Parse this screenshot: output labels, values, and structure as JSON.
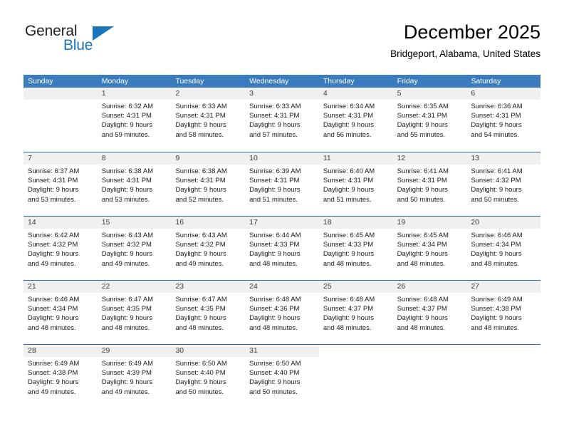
{
  "brand": {
    "word1": "General",
    "word2": "Blue",
    "triangle_color": "#1b75bb",
    "logo_icon": "general-blue-triangle-logo"
  },
  "header": {
    "title": "December 2025",
    "subtitle": "Bridgeport, Alabama, United States"
  },
  "theme": {
    "header_blue": "#3a7cbe",
    "row_divider_blue": "#2b6cad",
    "day_header_gray": "#f0f0f0",
    "text_color": "#000000"
  },
  "weekdays": [
    "Sunday",
    "Monday",
    "Tuesday",
    "Wednesday",
    "Thursday",
    "Friday",
    "Saturday"
  ],
  "weeks": [
    [
      {
        "day": "",
        "sunrise": "",
        "sunset": "",
        "daylight1": "",
        "daylight2": "",
        "empty": true
      },
      {
        "day": "1",
        "sunrise": "Sunrise: 6:32 AM",
        "sunset": "Sunset: 4:31 PM",
        "daylight1": "Daylight: 9 hours",
        "daylight2": "and 59 minutes.",
        "empty": false
      },
      {
        "day": "2",
        "sunrise": "Sunrise: 6:33 AM",
        "sunset": "Sunset: 4:31 PM",
        "daylight1": "Daylight: 9 hours",
        "daylight2": "and 58 minutes.",
        "empty": false
      },
      {
        "day": "3",
        "sunrise": "Sunrise: 6:33 AM",
        "sunset": "Sunset: 4:31 PM",
        "daylight1": "Daylight: 9 hours",
        "daylight2": "and 57 minutes.",
        "empty": false
      },
      {
        "day": "4",
        "sunrise": "Sunrise: 6:34 AM",
        "sunset": "Sunset: 4:31 PM",
        "daylight1": "Daylight: 9 hours",
        "daylight2": "and 56 minutes.",
        "empty": false
      },
      {
        "day": "5",
        "sunrise": "Sunrise: 6:35 AM",
        "sunset": "Sunset: 4:31 PM",
        "daylight1": "Daylight: 9 hours",
        "daylight2": "and 55 minutes.",
        "empty": false
      },
      {
        "day": "6",
        "sunrise": "Sunrise: 6:36 AM",
        "sunset": "Sunset: 4:31 PM",
        "daylight1": "Daylight: 9 hours",
        "daylight2": "and 54 minutes.",
        "empty": false
      }
    ],
    [
      {
        "day": "7",
        "sunrise": "Sunrise: 6:37 AM",
        "sunset": "Sunset: 4:31 PM",
        "daylight1": "Daylight: 9 hours",
        "daylight2": "and 53 minutes.",
        "empty": false
      },
      {
        "day": "8",
        "sunrise": "Sunrise: 6:38 AM",
        "sunset": "Sunset: 4:31 PM",
        "daylight1": "Daylight: 9 hours",
        "daylight2": "and 53 minutes.",
        "empty": false
      },
      {
        "day": "9",
        "sunrise": "Sunrise: 6:38 AM",
        "sunset": "Sunset: 4:31 PM",
        "daylight1": "Daylight: 9 hours",
        "daylight2": "and 52 minutes.",
        "empty": false
      },
      {
        "day": "10",
        "sunrise": "Sunrise: 6:39 AM",
        "sunset": "Sunset: 4:31 PM",
        "daylight1": "Daylight: 9 hours",
        "daylight2": "and 51 minutes.",
        "empty": false
      },
      {
        "day": "11",
        "sunrise": "Sunrise: 6:40 AM",
        "sunset": "Sunset: 4:31 PM",
        "daylight1": "Daylight: 9 hours",
        "daylight2": "and 51 minutes.",
        "empty": false
      },
      {
        "day": "12",
        "sunrise": "Sunrise: 6:41 AM",
        "sunset": "Sunset: 4:31 PM",
        "daylight1": "Daylight: 9 hours",
        "daylight2": "and 50 minutes.",
        "empty": false
      },
      {
        "day": "13",
        "sunrise": "Sunrise: 6:41 AM",
        "sunset": "Sunset: 4:32 PM",
        "daylight1": "Daylight: 9 hours",
        "daylight2": "and 50 minutes.",
        "empty": false
      }
    ],
    [
      {
        "day": "14",
        "sunrise": "Sunrise: 6:42 AM",
        "sunset": "Sunset: 4:32 PM",
        "daylight1": "Daylight: 9 hours",
        "daylight2": "and 49 minutes.",
        "empty": false
      },
      {
        "day": "15",
        "sunrise": "Sunrise: 6:43 AM",
        "sunset": "Sunset: 4:32 PM",
        "daylight1": "Daylight: 9 hours",
        "daylight2": "and 49 minutes.",
        "empty": false
      },
      {
        "day": "16",
        "sunrise": "Sunrise: 6:43 AM",
        "sunset": "Sunset: 4:32 PM",
        "daylight1": "Daylight: 9 hours",
        "daylight2": "and 49 minutes.",
        "empty": false
      },
      {
        "day": "17",
        "sunrise": "Sunrise: 6:44 AM",
        "sunset": "Sunset: 4:33 PM",
        "daylight1": "Daylight: 9 hours",
        "daylight2": "and 48 minutes.",
        "empty": false
      },
      {
        "day": "18",
        "sunrise": "Sunrise: 6:45 AM",
        "sunset": "Sunset: 4:33 PM",
        "daylight1": "Daylight: 9 hours",
        "daylight2": "and 48 minutes.",
        "empty": false
      },
      {
        "day": "19",
        "sunrise": "Sunrise: 6:45 AM",
        "sunset": "Sunset: 4:34 PM",
        "daylight1": "Daylight: 9 hours",
        "daylight2": "and 48 minutes.",
        "empty": false
      },
      {
        "day": "20",
        "sunrise": "Sunrise: 6:46 AM",
        "sunset": "Sunset: 4:34 PM",
        "daylight1": "Daylight: 9 hours",
        "daylight2": "and 48 minutes.",
        "empty": false
      }
    ],
    [
      {
        "day": "21",
        "sunrise": "Sunrise: 6:46 AM",
        "sunset": "Sunset: 4:34 PM",
        "daylight1": "Daylight: 9 hours",
        "daylight2": "and 48 minutes.",
        "empty": false
      },
      {
        "day": "22",
        "sunrise": "Sunrise: 6:47 AM",
        "sunset": "Sunset: 4:35 PM",
        "daylight1": "Daylight: 9 hours",
        "daylight2": "and 48 minutes.",
        "empty": false
      },
      {
        "day": "23",
        "sunrise": "Sunrise: 6:47 AM",
        "sunset": "Sunset: 4:35 PM",
        "daylight1": "Daylight: 9 hours",
        "daylight2": "and 48 minutes.",
        "empty": false
      },
      {
        "day": "24",
        "sunrise": "Sunrise: 6:48 AM",
        "sunset": "Sunset: 4:36 PM",
        "daylight1": "Daylight: 9 hours",
        "daylight2": "and 48 minutes.",
        "empty": false
      },
      {
        "day": "25",
        "sunrise": "Sunrise: 6:48 AM",
        "sunset": "Sunset: 4:37 PM",
        "daylight1": "Daylight: 9 hours",
        "daylight2": "and 48 minutes.",
        "empty": false
      },
      {
        "day": "26",
        "sunrise": "Sunrise: 6:48 AM",
        "sunset": "Sunset: 4:37 PM",
        "daylight1": "Daylight: 9 hours",
        "daylight2": "and 48 minutes.",
        "empty": false
      },
      {
        "day": "27",
        "sunrise": "Sunrise: 6:49 AM",
        "sunset": "Sunset: 4:38 PM",
        "daylight1": "Daylight: 9 hours",
        "daylight2": "and 48 minutes.",
        "empty": false
      }
    ],
    [
      {
        "day": "28",
        "sunrise": "Sunrise: 6:49 AM",
        "sunset": "Sunset: 4:38 PM",
        "daylight1": "Daylight: 9 hours",
        "daylight2": "and 49 minutes.",
        "empty": false
      },
      {
        "day": "29",
        "sunrise": "Sunrise: 6:49 AM",
        "sunset": "Sunset: 4:39 PM",
        "daylight1": "Daylight: 9 hours",
        "daylight2": "and 49 minutes.",
        "empty": false
      },
      {
        "day": "30",
        "sunrise": "Sunrise: 6:50 AM",
        "sunset": "Sunset: 4:40 PM",
        "daylight1": "Daylight: 9 hours",
        "daylight2": "and 50 minutes.",
        "empty": false
      },
      {
        "day": "31",
        "sunrise": "Sunrise: 6:50 AM",
        "sunset": "Sunset: 4:40 PM",
        "daylight1": "Daylight: 9 hours",
        "daylight2": "and 50 minutes.",
        "empty": false
      },
      {
        "day": "",
        "sunrise": "",
        "sunset": "",
        "daylight1": "",
        "daylight2": "",
        "empty": true,
        "nodata": true
      },
      {
        "day": "",
        "sunrise": "",
        "sunset": "",
        "daylight1": "",
        "daylight2": "",
        "empty": true,
        "nodata": true
      },
      {
        "day": "",
        "sunrise": "",
        "sunset": "",
        "daylight1": "",
        "daylight2": "",
        "empty": true,
        "nodata": true
      }
    ]
  ]
}
